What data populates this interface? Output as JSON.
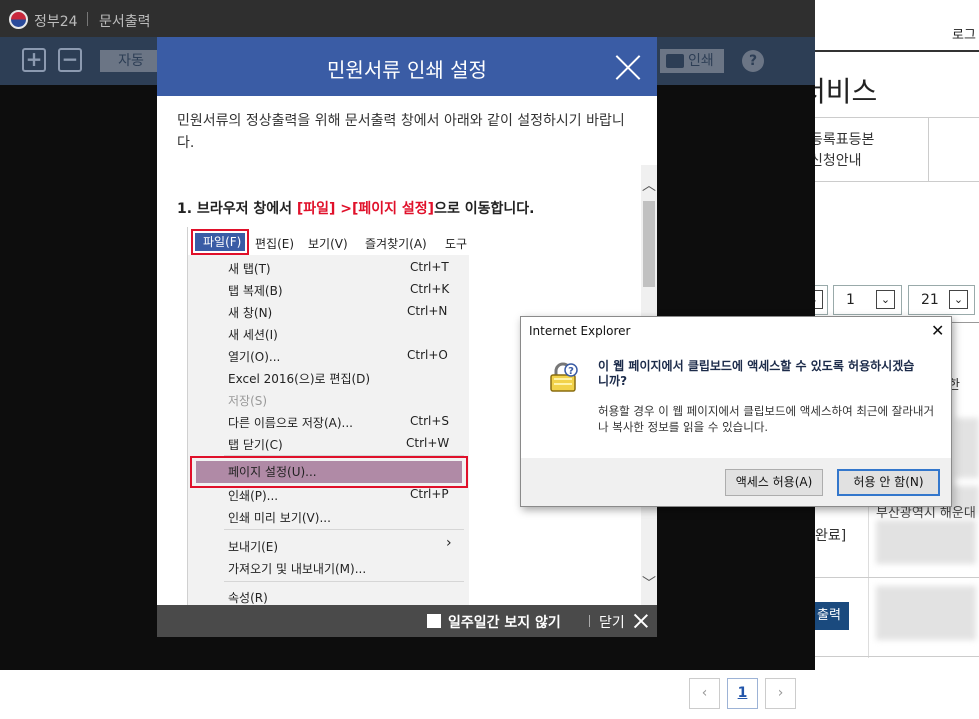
{
  "background_page": {
    "login_text": "로그",
    "service_title": "서비스",
    "menu_line1": "등록표등본",
    "menu_line2": "신청안내",
    "select1_value": "1",
    "select2_value": "21",
    "table_header_fragment": "한",
    "row_status": "완료]",
    "address_fragment": "부산광역시 해운대",
    "print_button": "출력",
    "pagination": {
      "prev": "‹",
      "current": "1",
      "next": "›"
    }
  },
  "viewer": {
    "brand": "정부24",
    "window_title": "문서출력",
    "zoom_in": "+",
    "zoom_out": "−",
    "auto_label": "자동",
    "print_label": "인쇄",
    "help_label": "?"
  },
  "print_dialog": {
    "title": "민원서류 인쇄 설정",
    "intro": "민원서류의 정상출력을 위해 문서출력 창에서 아래와 같이 설정하시기 바랍니다.",
    "step1_prefix": "1. 브라우저 창에서 ",
    "step1_highlight": "[파일] >[페이지 설정]",
    "step1_suffix": "으로 이동합니다.",
    "menubar": [
      "파일(F)",
      "편집(E)",
      "보기(V)",
      "즐겨찾기(A)",
      "도구"
    ],
    "menu_items": [
      {
        "label": "새 탭(T)",
        "shortcut": "Ctrl+T"
      },
      {
        "label": "탭 복제(B)",
        "shortcut": "Ctrl+K"
      },
      {
        "label": "새 창(N)",
        "shortcut": "Ctrl+N"
      },
      {
        "label": "새 세션(I)",
        "shortcut": ""
      },
      {
        "label": "열기(O)...",
        "shortcut": "Ctrl+O"
      },
      {
        "label": "Excel 2016(으)로 편집(D)",
        "shortcut": ""
      },
      {
        "label": "저장(S)",
        "shortcut": ""
      },
      {
        "label": "다른 이름으로 저장(A)...",
        "shortcut": "Ctrl+S"
      },
      {
        "label": "탭 닫기(C)",
        "shortcut": "Ctrl+W"
      },
      {
        "label": "페이지 설정(U)...",
        "shortcut": ""
      },
      {
        "label": "인쇄(P)...",
        "shortcut": "Ctrl+P"
      },
      {
        "label": "인쇄 미리 보기(V)...",
        "shortcut": ""
      },
      {
        "label": "보내기(E)",
        "shortcut": "›"
      },
      {
        "label": "가져오기 및 내보내기(M)...",
        "shortcut": ""
      },
      {
        "label": "속성(R)",
        "shortcut": ""
      }
    ],
    "footer_checkbox": "일주일간 보지 않기",
    "footer_close": "닫기"
  },
  "ie_alert": {
    "title": "Internet Explorer",
    "question": "이 웹 페이지에서 클립보드에 액세스할 수 있도록 허용하시겠습니까?",
    "description": "허용할 경우 이 웹 페이지에서 클립보드에 액세스하여 최근에 잘라내거나 복사한 정보를 읽을 수 있습니다.",
    "allow_button": "액세스 허용(A)",
    "deny_button": "허용 안 함(N)"
  },
  "colors": {
    "dialog_header": "#3a5ca5",
    "highlight_red": "#e0102a",
    "viewer_toolbar": "#2d3e55"
  }
}
